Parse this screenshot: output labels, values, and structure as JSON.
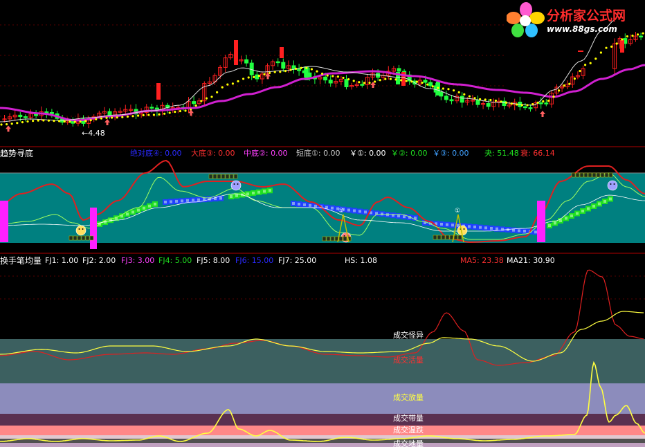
{
  "logo": {
    "title": "分析家公式网",
    "url": "www.88gs.com"
  },
  "price_panel": {
    "low_marker": "←4.48"
  },
  "panel2": {
    "title": "趋势寻底",
    "items": [
      {
        "text": "绝对底④: 0.00",
        "color": "#2a2aff"
      },
      {
        "text": "大底③: 0.00",
        "color": "#ff3030"
      },
      {
        "text": "中底②: 0.00",
        "color": "#ff40ff"
      },
      {
        "text": "短底①: 0.00",
        "color": "#c8c8c8"
      },
      {
        "text": "￥①: 0.00",
        "color": "#ffffff"
      },
      {
        "text": "￥②: 0.00",
        "color": "#20e020"
      },
      {
        "text": "￥③: 0.00",
        "color": "#40a0ff"
      },
      {
        "text": "夬: 51.48",
        "color": "#20e020"
      },
      {
        "text": "衰: 66.14",
        "color": "#ff3030"
      }
    ],
    "circle_mark": "①"
  },
  "panel3": {
    "title": "换手笔均量",
    "items": [
      {
        "text": "FJ1: 1.00",
        "color": "#ffffff"
      },
      {
        "text": "FJ2: 2.00",
        "color": "#ffffff"
      },
      {
        "text": "FJ3: 3.00",
        "color": "#ff40ff"
      },
      {
        "text": "FJ4: 5.00",
        "color": "#20e020"
      },
      {
        "text": "FJ5: 8.00",
        "color": "#ffffff"
      },
      {
        "text": "FJ6: 15.00",
        "color": "#2a2aff"
      },
      {
        "text": "FJ7: 25.00",
        "color": "#ffffff"
      },
      {
        "text": "HS: 1.08",
        "color": "#ffffff"
      },
      {
        "text": "MA5: 23.38",
        "color": "#ff3030"
      },
      {
        "text": "MA21: 30.90",
        "color": "#ffffff"
      }
    ],
    "zone_labels": [
      "成交怪异",
      "成交活量",
      "成交放量",
      "成交带量",
      "成交温跌",
      "成交地量"
    ],
    "zone_label_colors": [
      "#ffffff",
      "#ff3030",
      "#ffff40",
      "#ffffff",
      "#ffffff",
      "#ffffff"
    ]
  },
  "chart_data": [
    {
      "type": "candlestick",
      "title": "",
      "annotations": [
        "←4.48"
      ],
      "series": [],
      "colors": {
        "up": "#ff2020",
        "down": "#20ff40",
        "ma_main": "#d020d0",
        "ma_fast": "#ffff00"
      }
    },
    {
      "type": "line",
      "title": "趋势寻底",
      "legend": [
        "绝对底④: 0.00",
        "大底③: 0.00",
        "中底②: 0.00",
        "短底①: 0.00",
        "￥①: 0.00",
        "￥②: 0.00",
        "￥③: 0.00",
        "夬: 51.48",
        "衰: 66.14"
      ],
      "series": [
        {
          "name": "夬",
          "last": 51.48
        },
        {
          "name": "衰",
          "last": 66.14
        }
      ]
    },
    {
      "type": "line",
      "title": "换手笔均量",
      "legend": [
        "FJ1: 1.00",
        "FJ2: 2.00",
        "FJ3: 3.00",
        "FJ4: 5.00",
        "FJ5: 8.00",
        "FJ6: 15.00",
        "FJ7: 25.00",
        "HS: 1.08",
        "MA5: 23.38",
        "MA21: 30.90"
      ],
      "series": [
        {
          "name": "HS",
          "last": 1.08
        },
        {
          "name": "MA5",
          "last": 23.38
        },
        {
          "name": "MA21",
          "last": 30.9
        }
      ],
      "zones": [
        "成交怪异",
        "成交活量",
        "成交放量",
        "成交带量",
        "成交温跌",
        "成交地量"
      ]
    }
  ]
}
